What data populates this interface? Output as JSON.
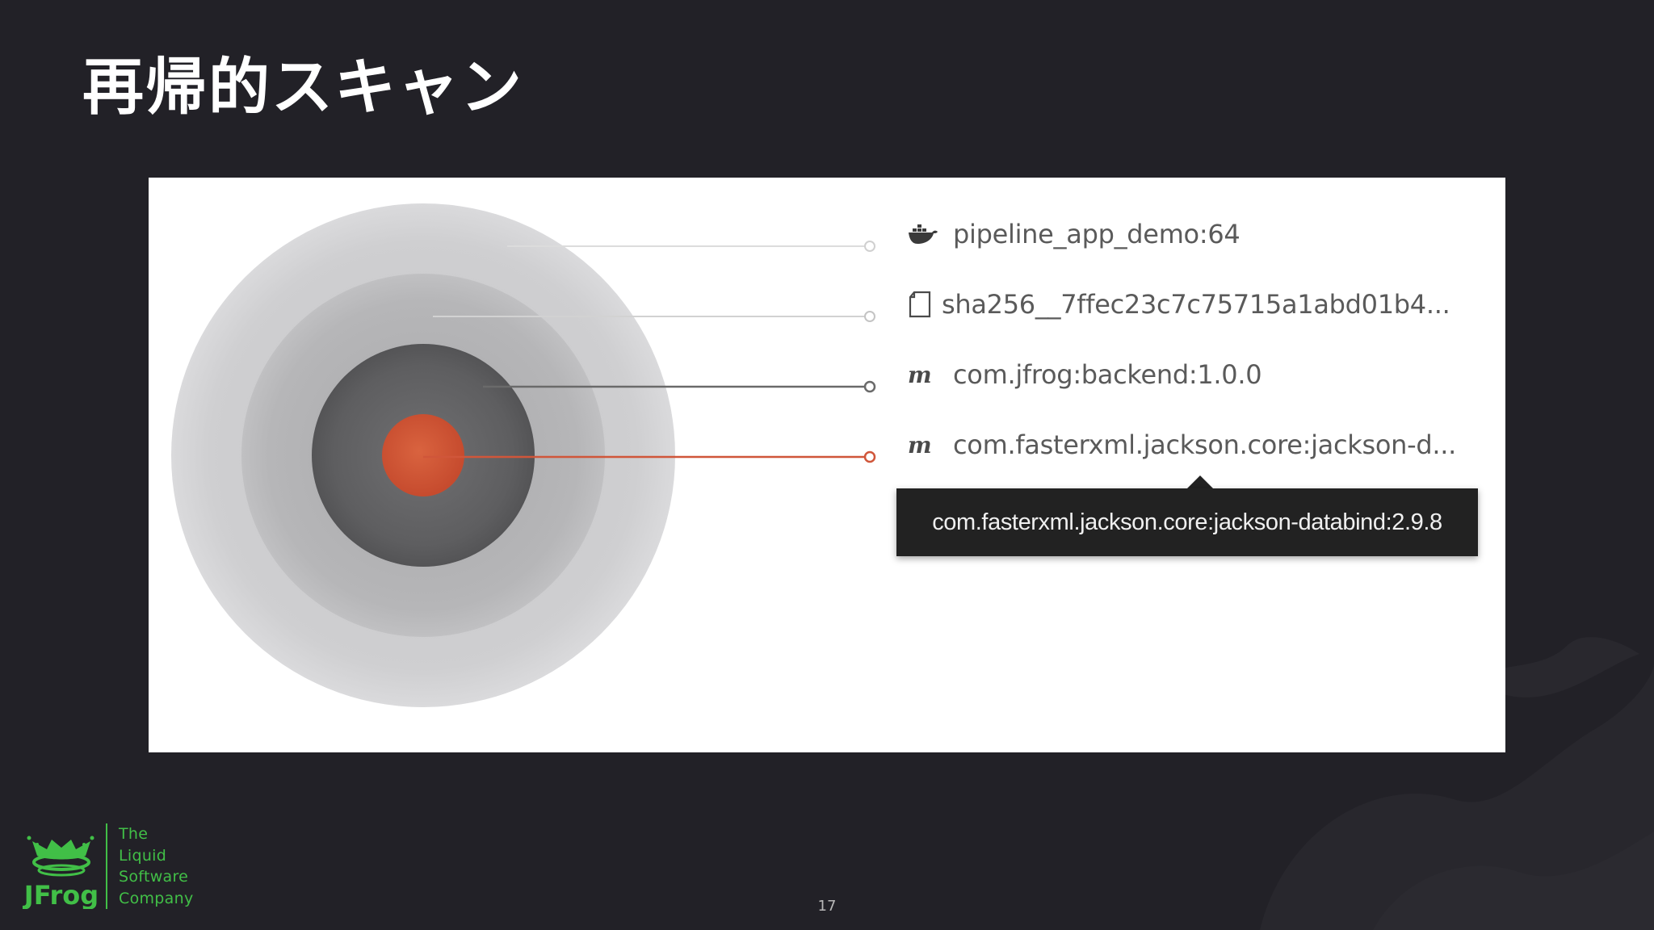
{
  "slide": {
    "title": "再帰的スキャン",
    "page_number": "17"
  },
  "layers": [
    {
      "icon": "docker-icon",
      "label": "pipeline_app_demo:64"
    },
    {
      "icon": "file-icon",
      "label": "sha256__7ffec23c7c75715a1abd01b4..."
    },
    {
      "icon": "maven-icon",
      "icon_text": "m",
      "label": "com.jfrog:backend:1.0.0"
    },
    {
      "icon": "maven-icon",
      "icon_text": "m",
      "label": "com.fasterxml.jackson.core:jackson-d..."
    }
  ],
  "tooltip": {
    "text": "com.fasterxml.jackson.core:jackson-databind:2.9.8"
  },
  "branding": {
    "logo_text": "JFrog",
    "tagline": [
      "The",
      "Liquid",
      "Software",
      "Company"
    ],
    "brand_color": "#41bf47"
  },
  "colors": {
    "background": "#222127",
    "highlight": "#d0563a"
  }
}
